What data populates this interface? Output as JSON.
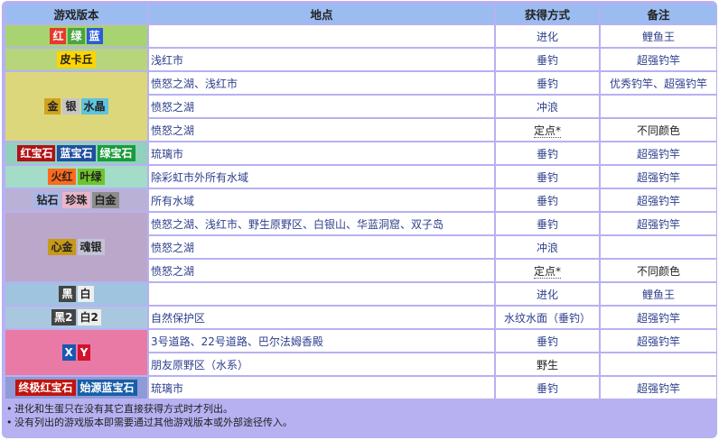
{
  "headers": {
    "version": "游戏版本",
    "location": "地点",
    "method": "获得方式",
    "note": "备注"
  },
  "colors": {
    "red": "#e53a2c",
    "green": "#4aa543",
    "blue": "#2c5cd8",
    "yellow": "#ffd400",
    "gold": "#d1a31e",
    "silver": "#c6c6c6",
    "crystal": "#5fc3e0",
    "ruby": "#b11116",
    "sapphire": "#1e4fa0",
    "emerald": "#1a9b3c",
    "firered": "#ff6a1a",
    "leafgreen": "#6ec42b",
    "diamond": "#a8b7e8",
    "pearl": "#e8b6c9",
    "platinum": "#8c8c8c",
    "heartgold": "#c79a17",
    "soulsilver": "#c3c3d6",
    "black": "#444444",
    "white": "#eeeeee",
    "x": "#1a57b5",
    "y": "#d1132e",
    "omegaruby": "#c0150e",
    "alphasapphire": "#175fa8"
  },
  "rows": [
    {
      "loc": "",
      "method": "进化",
      "note": "鲤鱼王"
    },
    {
      "loc": "浅红市",
      "method": "垂钓",
      "note": "超强钓竿"
    },
    {
      "loc": "愤怒之湖、浅红市",
      "method": "垂钓",
      "note": "优秀钓竿、超强钓竿"
    },
    {
      "loc": "愤怒之湖",
      "method": "冲浪",
      "note": ""
    },
    {
      "loc": "愤怒之湖",
      "method": "定点*",
      "note": "不同颜色"
    },
    {
      "loc": "琉璃市",
      "method": "垂钓",
      "note": "超强钓竿"
    },
    {
      "loc": "除彩虹市外所有水域",
      "method": "垂钓",
      "note": "超强钓竿"
    },
    {
      "loc": "所有水域",
      "method": "垂钓",
      "note": "超强钓竿"
    },
    {
      "loc": "愤怒之湖、浅红市、野生原野区、白银山、华蓝洞窟、双子岛",
      "method": "垂钓",
      "note": "超强钓竿"
    },
    {
      "loc": "愤怒之湖",
      "method": "冲浪",
      "note": ""
    },
    {
      "loc": "愤怒之湖",
      "method": "定点*",
      "note": "不同颜色"
    },
    {
      "loc": "",
      "method": "进化",
      "note": "鲤鱼王"
    },
    {
      "loc": "自然保护区",
      "method": "水纹水面（垂钓）",
      "note": "超强钓竿"
    },
    {
      "loc": "3号道路、22号道路、巴尔法姆香殿",
      "method": "垂钓",
      "note": "超强钓竿"
    },
    {
      "loc": "朋友原野区（水系）",
      "method": "野生",
      "note": ""
    },
    {
      "loc": "琉璃市",
      "method": "垂钓",
      "note": "超强钓竿"
    }
  ],
  "versions": {
    "rgb": [
      "红",
      "绿",
      "蓝"
    ],
    "yellow": [
      "皮卡丘"
    ],
    "gsc": [
      "金",
      "银",
      "水晶"
    ],
    "rse": [
      "红宝石",
      "蓝宝石",
      "绿宝石"
    ],
    "frlg": [
      "火红",
      "叶绿"
    ],
    "dpp": [
      "钻石",
      "珍珠",
      "白金"
    ],
    "hgss": [
      "心金",
      "魂银"
    ],
    "bw": [
      "黑",
      "白"
    ],
    "bw2": [
      "黑2",
      "白2"
    ],
    "xy": [
      "X",
      "Y"
    ],
    "oras": [
      "终极红宝石",
      "始源蓝宝石"
    ]
  },
  "notes": [
    "进化和生蛋只在没有其它直接获得方式时才列出。",
    "没有列出的游戏版本即需要通过其他游戏版本或外部途径传入。"
  ]
}
